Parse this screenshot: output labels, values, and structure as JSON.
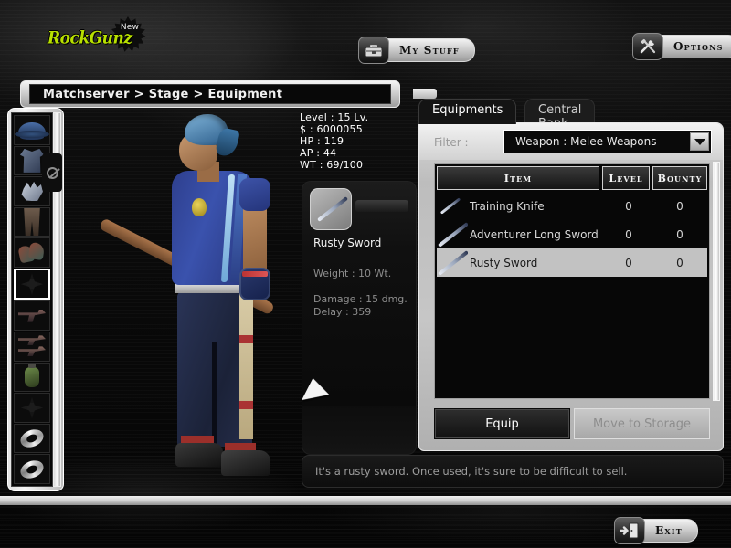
{
  "logo": {
    "text": "RockGunz",
    "badge": "New"
  },
  "topbar": {
    "my_stuff": {
      "label": "My Stuff",
      "icon": "suitcase-icon"
    },
    "options": {
      "label": "Options",
      "icon": "tools-icon"
    }
  },
  "breadcrumb": {
    "text": "Matchserver > Stage > Equipment"
  },
  "stats": {
    "level": "Level : 15 Lv.",
    "money": "$ : 6000055",
    "hp": "HP : 119",
    "ap": "AP : 44",
    "wt": "WT : 69/100"
  },
  "slots": [
    {
      "name": "slot-head",
      "icon": "hat-icon",
      "empty": false,
      "selected": false
    },
    {
      "name": "slot-chest",
      "icon": "jacket-icon",
      "empty": false,
      "selected": false
    },
    {
      "name": "slot-hands",
      "icon": "gloves-icon",
      "empty": false,
      "selected": false
    },
    {
      "name": "slot-legs",
      "icon": "pants-icon",
      "empty": false,
      "selected": false
    },
    {
      "name": "slot-feet",
      "icon": "boots-icon",
      "empty": false,
      "selected": false
    },
    {
      "name": "slot-melee",
      "icon": "empty-slot-icon",
      "empty": true,
      "selected": true
    },
    {
      "name": "slot-primary",
      "icon": "pistol-icon",
      "empty": false,
      "selected": false
    },
    {
      "name": "slot-secondary",
      "icon": "dual-pistols-icon",
      "empty": false,
      "selected": false
    },
    {
      "name": "slot-grenade",
      "icon": "grenade-icon",
      "empty": false,
      "selected": false
    },
    {
      "name": "slot-custom",
      "icon": "empty-slot-icon",
      "empty": true,
      "selected": false
    },
    {
      "name": "slot-ring-1",
      "icon": "ring-icon",
      "empty": false,
      "selected": false
    },
    {
      "name": "slot-ring-2",
      "icon": "ring-icon",
      "empty": false,
      "selected": false
    }
  ],
  "item_detail": {
    "name": "Rusty Sword",
    "weight": "Weight : 10 Wt.",
    "damage": "Damage : 15 dmg.",
    "delay": "Delay : 359"
  },
  "description": "It's a rusty sword. Once used, it's sure to be difficult to sell.",
  "equipment_panel": {
    "tabs": [
      {
        "label": "Equipments",
        "active": true
      },
      {
        "label": "Central Bank",
        "active": false
      }
    ],
    "filter_label": "Filter :",
    "filter_value": "Weapon : Melee Weapons",
    "columns": {
      "item": "Item",
      "level": "Level",
      "bounty": "Bounty"
    },
    "rows": [
      {
        "name": "Training Knife",
        "level": "0",
        "bounty": "0",
        "selected": false
      },
      {
        "name": "Adventurer Long Sword",
        "level": "0",
        "bounty": "0",
        "selected": false
      },
      {
        "name": "Rusty Sword",
        "level": "0",
        "bounty": "0",
        "selected": true
      }
    ],
    "equip_button": "Equip",
    "storage_button": "Move to Storage"
  },
  "exit": {
    "label": "Exit",
    "icon": "exit-door-icon"
  },
  "colors": {
    "logo_green": "#b8e000",
    "panel_light": "#c6c6c6",
    "selection": "#c2c2c2",
    "text_dim": "#9d9d9d"
  }
}
